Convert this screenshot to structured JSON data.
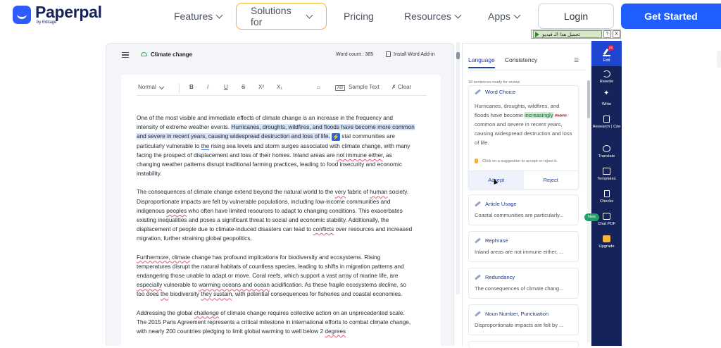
{
  "brand": {
    "name": "Paperpal",
    "sub": "by Editage",
    "color": "#2e5bff"
  },
  "nav": {
    "features": "Features",
    "solutions": "Solutions for",
    "pricing": "Pricing",
    "resources": "Resources",
    "apps": "Apps",
    "login": "Login",
    "get_started": "Get Started"
  },
  "overlay": {
    "label": "تحميل هذا الـ فيديو",
    "help": "?",
    "close": "X"
  },
  "editor": {
    "title": "Climate change",
    "word_count": "Word count : 385",
    "add_in": "Install Word Add-in",
    "toolbar": {
      "style": "Normal",
      "bold": "B",
      "italic": "I",
      "underline": "U",
      "strike": "S",
      "superscript": "X²",
      "subscript": "X₁",
      "sample_box": "AB",
      "sample": "Sample Text",
      "clear": "Clear"
    },
    "p1": {
      "a": "One of the most visible and immediate effects of climate change is an increase in the frequency and intensity of extreme weather events. ",
      "hl": "Hurricanes, droughts, wildfires, and floods have become more common and severe in recent years, causing widespread destruction and loss of life.",
      "b": "stal communities are particularly vulnerable to ",
      "the": "the",
      "c": " rising sea levels and storm surges associated with climate change, with many facing the prospect of displacement and loss of their homes. Inland areas are ",
      "not_immune": "not immune either",
      "d": ", as changing weather patterns disrupt traditional farming practices, leading to food insecurity and economic instability."
    },
    "p2": {
      "a": "The consequences of climate change extend beyond the natural world to the ",
      "very": "very",
      "b": " fabric of ",
      "human": "human",
      "c": " society. Disproportionate impacts are felt by vulnerable populations, including low-income communities and indigenous ",
      "peoples": "peoples",
      "d": " who often have limited resources to adapt to changing conditions. This exacerbates existing inequalities and poses a significant threat to social and economic stability. Additionally, the displacement of people due to climate-induced disasters can lead to ",
      "conflicts": "conflicts",
      "e": " over resources and increased migration, further straining global geopolitics."
    },
    "p3": {
      "furthermore": "Furthermore, climate",
      "a": " change has profound implications for biodiversity and ecosystems. Rising temperatures disrupt the natural habitats of countless species, leading to shifts in migration patterns and endangering those unable to adapt or move. Coral reefs, which support a vast array of marine life, are ",
      "especially": "especially",
      "b": " vulnerable to ",
      "warming": "warming oceans and ocean",
      "c": " acidification. As these fragile ecosystems decline, so too does ",
      "the": "the",
      "d": " biodiversity ",
      "they_sustain": "they sustain",
      "e": ", with potential consequences for fisheries and coastal economies."
    },
    "p4": {
      "a": "Addressing the global ",
      "challenge": "challenge",
      "b": " of climate change requires collective action on an unprecedented scale. The 2015 Paris Agreement represents a critical milestone in international efforts to combat climate change, with nearly 200 countries pledging to limit global warming to well below 2 ",
      "degrees": "degrees"
    }
  },
  "panel": {
    "tabs": [
      "Language",
      "Consistency"
    ],
    "ready": "18 sentences ready for review",
    "active": {
      "type": "Word Choice",
      "before": "Hurricanes, droughts, wildfires, and floods have become ",
      "insert": "increasingly",
      "delete": "more",
      "after": " common and severe in recent years, causing widespread destruction and loss of life.",
      "hint": "Click on a suggestion to accept or reject it.",
      "accept": "Accept",
      "reject": "Reject"
    },
    "cards": [
      {
        "type": "Article Usage",
        "preview": "Coastal communities are particularly..."
      },
      {
        "type": "Rephrase",
        "preview": "Inland areas are not immune either, ..."
      },
      {
        "type": "Redundancy",
        "preview": "The consequences of climate chang..."
      },
      {
        "type": "Noun Number, Punctuation",
        "preview": "Disproportionate impacts are felt by ..."
      }
    ]
  },
  "rail": {
    "badge": "28",
    "new_badge": "New",
    "items": [
      "Edit",
      "Rewrite",
      "Write",
      "Research | Cite",
      "Translate",
      "Templates",
      "Checks",
      "Chat PDF",
      "Upgrade"
    ]
  }
}
